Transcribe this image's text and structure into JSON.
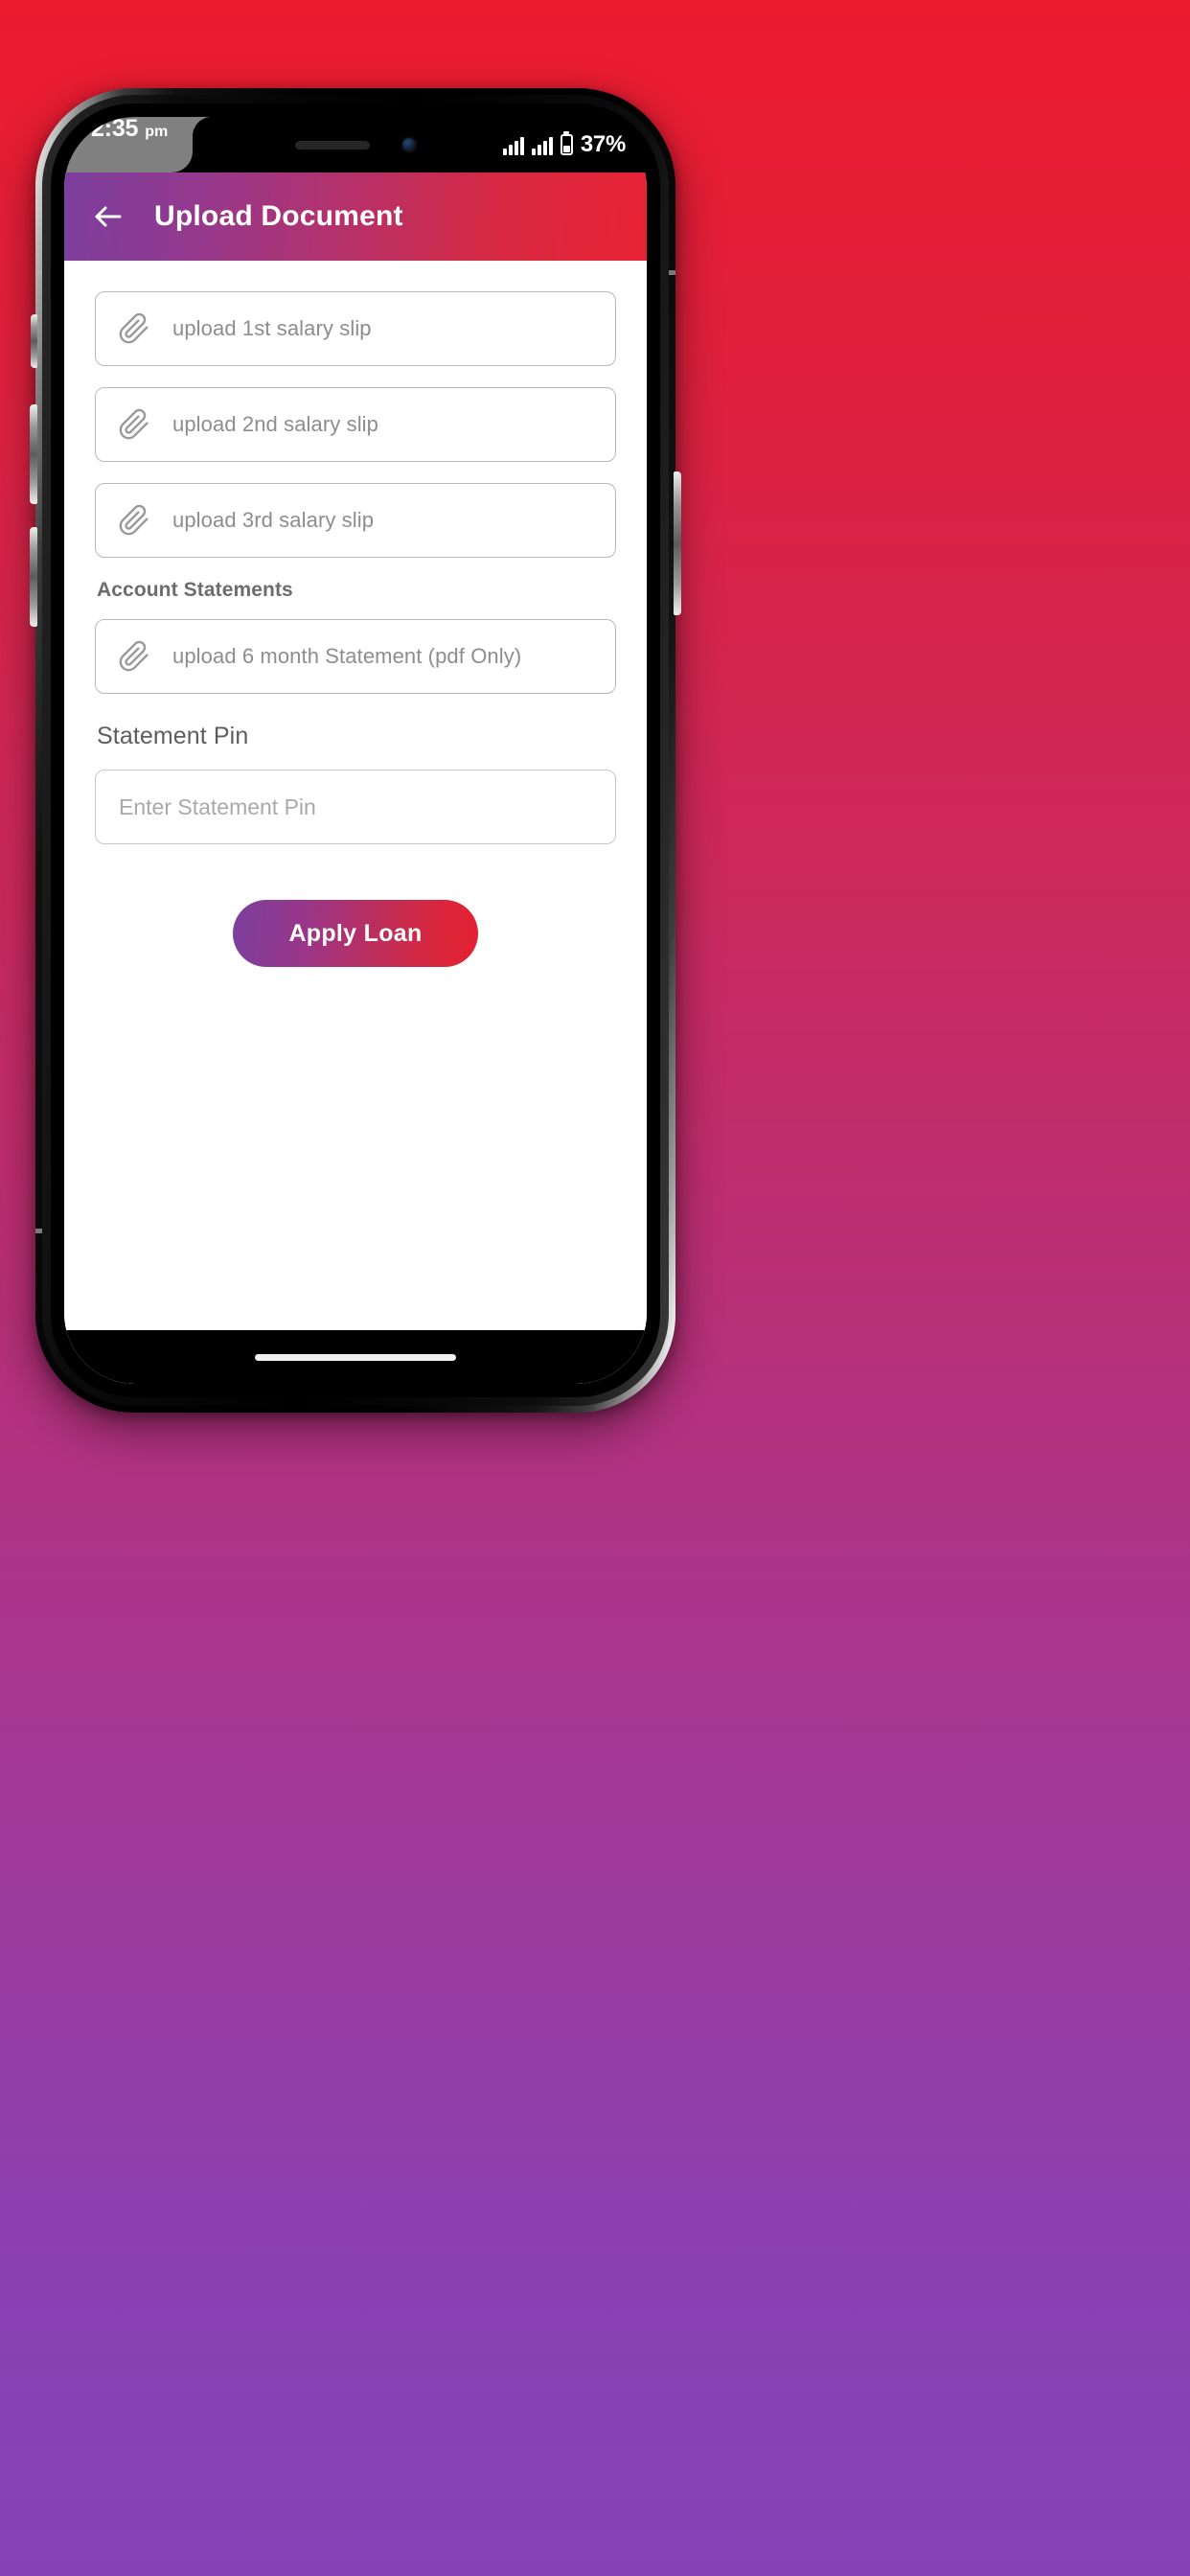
{
  "background": {
    "gradient_from": "#ec1b2e",
    "gradient_to": "#8542b6"
  },
  "status_bar": {
    "time": "2:35",
    "meridiem": "pm",
    "battery_percent": "37%",
    "battery_level": 37,
    "signal_icon": "signal-bars-icon",
    "battery_icon": "battery-icon"
  },
  "app_bar": {
    "back_icon": "back-arrow-icon",
    "title": "Upload Document",
    "gradient_from": "#7b3f9d",
    "gradient_to": "#e82234"
  },
  "content": {
    "salary_uploads": [
      {
        "icon": "paperclip-icon",
        "label": "upload 1st salary slip"
      },
      {
        "icon": "paperclip-icon",
        "label": "upload 2nd salary slip"
      },
      {
        "icon": "paperclip-icon",
        "label": "upload 3rd salary slip"
      }
    ],
    "account_statements_label": "Account Statements",
    "statement_upload": {
      "icon": "paperclip-icon",
      "label": "upload 6 month Statement (pdf Only)"
    },
    "statement_pin_label": "Statement Pin",
    "statement_pin_input": {
      "value": "",
      "placeholder": "Enter Statement Pin"
    },
    "apply_button_label": "Apply Loan"
  }
}
